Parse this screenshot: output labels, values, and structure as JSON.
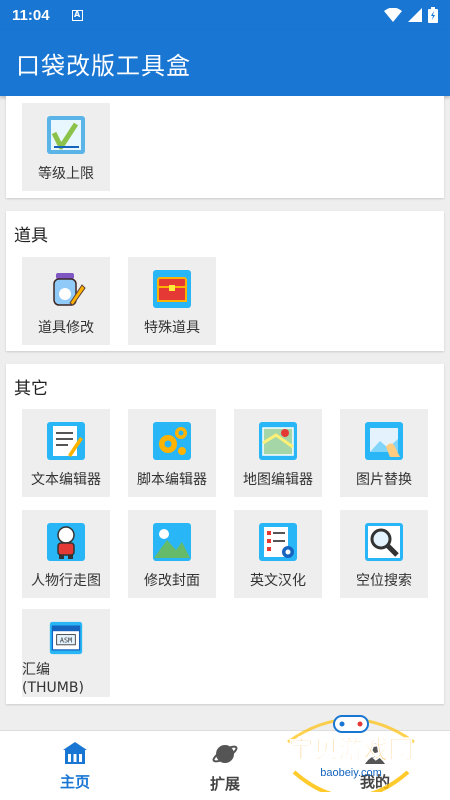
{
  "status_bar": {
    "time": "11:04",
    "notification": "A"
  },
  "app_bar": {
    "title": "口袋改版工具盒"
  },
  "sections": {
    "level": {
      "items": [
        {
          "label": "等级上限",
          "icon": "level-chart-icon"
        }
      ]
    },
    "items": {
      "title": "道具",
      "items": [
        {
          "label": "道具修改",
          "icon": "potion-edit-icon"
        },
        {
          "label": "特殊道具",
          "icon": "treasure-chest-icon"
        }
      ]
    },
    "other": {
      "title": "其它",
      "items": [
        {
          "label": "文本编辑器",
          "icon": "text-editor-icon"
        },
        {
          "label": "脚本编辑器",
          "icon": "gears-icon"
        },
        {
          "label": "地图编辑器",
          "icon": "map-icon"
        },
        {
          "label": "图片替换",
          "icon": "image-icon"
        },
        {
          "label": "人物行走图",
          "icon": "character-sprite-icon"
        },
        {
          "label": "修改封面",
          "icon": "mountain-cover-icon"
        },
        {
          "label": "英文汉化",
          "icon": "list-settings-icon"
        },
        {
          "label": "空位搜索",
          "icon": "magnifier-icon"
        },
        {
          "label": "汇编\n(THUMB)",
          "icon": "asm-window-icon"
        }
      ]
    }
  },
  "bottom_nav": [
    {
      "label": "主页",
      "icon": "home-icon",
      "active": true
    },
    {
      "label": "扩展",
      "icon": "planet-icon",
      "active": false
    },
    {
      "label": "我的",
      "icon": "person-icon",
      "active": false
    }
  ],
  "watermark": {
    "text": "宝贝游戏网",
    "url_text": "baobeiy.com"
  },
  "colors": {
    "primary": "#1976d2",
    "tile_bg": "#eeeeee",
    "page_bg": "#eeeeee"
  }
}
